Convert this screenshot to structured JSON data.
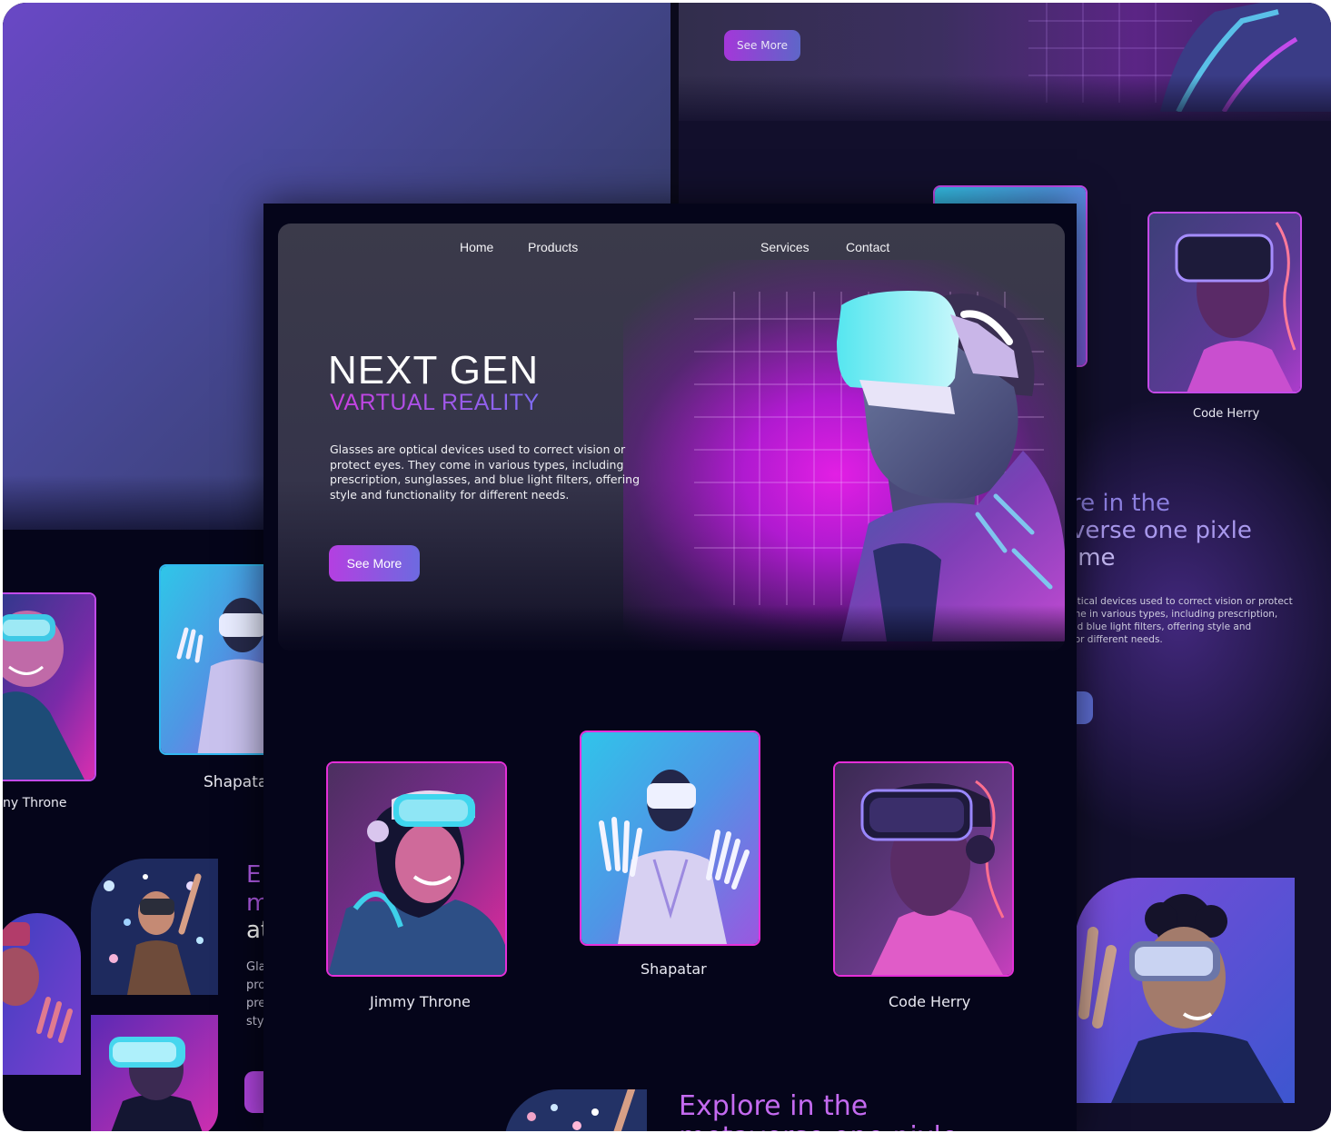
{
  "nav": {
    "home": "Home",
    "products": "Products",
    "services": "Services",
    "contact": "Contact"
  },
  "hero": {
    "title": "NEXT GEN",
    "subtitle": "VARTUAL REALITY",
    "description": "Glasses are optical devices used to correct vision or protect eyes. They come in various types, including prescription, sunglasses, and blue light filters, offering style and functionality for different needs.",
    "button": "See More"
  },
  "cards": [
    {
      "name": "Jimmy Throne"
    },
    {
      "name": "Shapatar"
    },
    {
      "name": "Code Herry"
    }
  ],
  "explore": {
    "heading": "Explore in the",
    "heading2": "metaverse one pixle"
  },
  "right_mock": {
    "button": "See More",
    "card_name": "Code Herry",
    "heading_lines": [
      "re in the",
      "verse one pixle",
      "ime"
    ],
    "desc_lines": [
      "ptical devices used to correct vision or protect",
      "me in various types, including prescription,",
      "nd blue light filters, offering style and",
      "for different needs."
    ]
  },
  "left_mock": {
    "card1_name": "ny Throne",
    "card2_name": "Shapata",
    "heading_lines": [
      "E",
      "m",
      "at"
    ],
    "desc_lines": [
      "Gla",
      "pro",
      "pre",
      "sty"
    ]
  },
  "colors": {
    "accent_pink": "#e72cd9",
    "accent_cyan": "#32b8f0",
    "bg_dark": "#05051a"
  }
}
